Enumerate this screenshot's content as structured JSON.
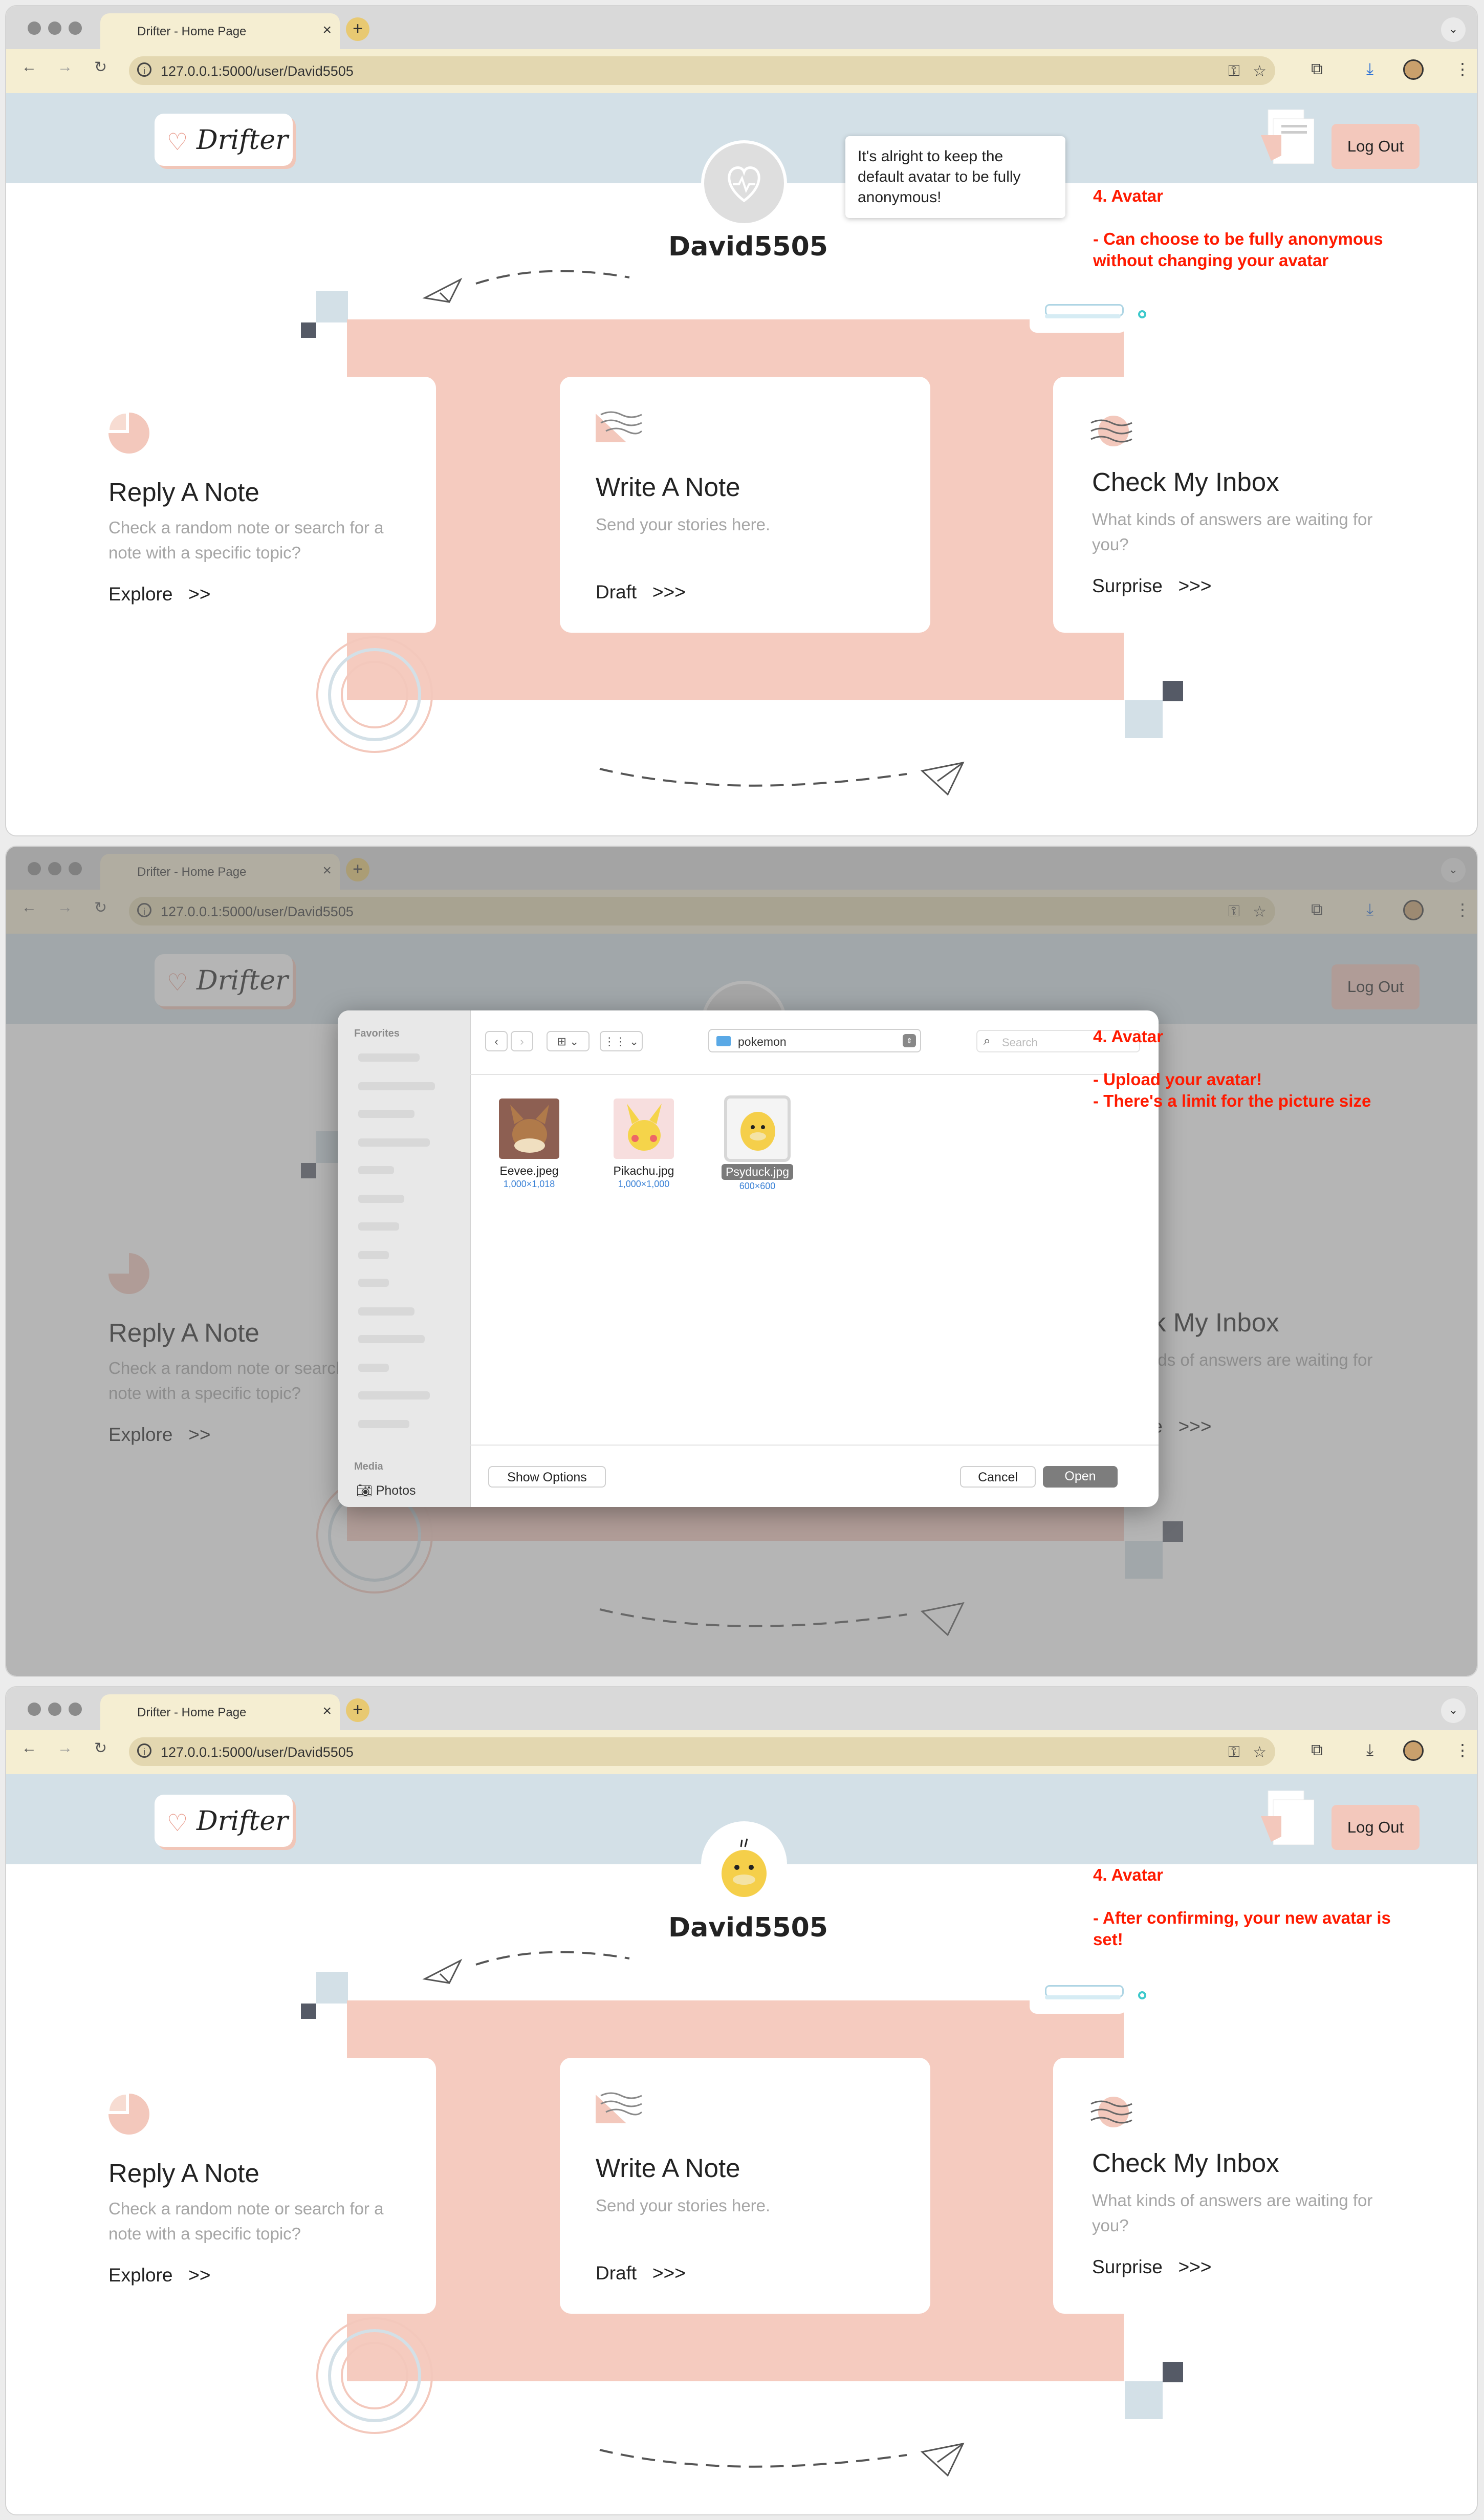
{
  "browser": {
    "tab_title": "Drifter - Home Page",
    "tab_close": "×",
    "new_tab": "+",
    "tab_menu": "⌄",
    "back": "←",
    "forward": "→",
    "reload": "↻",
    "url": "127.0.0.1:5000/user/David5505"
  },
  "site": {
    "logo_text": "Drifter",
    "logout_label": "Log Out",
    "username": "David5505",
    "cards": [
      {
        "title": "Reply A Note",
        "desc": "Check a random note or search for a note with a specific topic?",
        "link": "Explore   >>"
      },
      {
        "title": "Write A Note",
        "desc": "Send your stories here.",
        "link": "Draft   >>>"
      },
      {
        "title": "Check My Inbox",
        "desc": "What kinds of answers are waiting for you?",
        "link": "Surprise   >>>"
      }
    ]
  },
  "step1": {
    "tooltip": "It's alright to keep the default avatar to be fully anonymous!",
    "annot_title": "4. Avatar",
    "annot_lines": [
      "- Can choose to be fully anonymous",
      "without changing your avatar"
    ]
  },
  "step2": {
    "annot_title": "4. Avatar",
    "annot_lines": [
      "- Upload your avatar!",
      "- There's a limit for the picture size"
    ],
    "dialog": {
      "sidebar_favorites": "Favorites",
      "sidebar_media": "Media",
      "sidebar_photos": "Photos",
      "folder": "pokemon",
      "search_placeholder": "Search",
      "files": [
        {
          "name": "Eevee.jpeg",
          "dims": "1,000×1,018"
        },
        {
          "name": "Pikachu.jpg",
          "dims": "1,000×1,000"
        },
        {
          "name": "Psyduck.jpg",
          "dims": "600×600"
        }
      ],
      "show_options": "Show Options",
      "cancel": "Cancel",
      "open": "Open"
    }
  },
  "step3": {
    "annot_title": "4. Avatar",
    "annot_lines": [
      "- After confirming, your new avatar is",
      "set!"
    ]
  },
  "colors": {
    "header": "#d3e0e7",
    "pink": "#f5cbbf",
    "annotation": "#ff1a00",
    "logout": "#f3c8bc"
  }
}
